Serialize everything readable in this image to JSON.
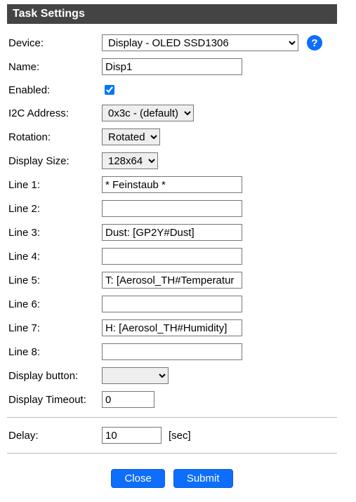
{
  "header": {
    "title": "Task Settings"
  },
  "labels": {
    "device": "Device:",
    "name": "Name:",
    "enabled": "Enabled:",
    "i2c": "I2C Address:",
    "rotation": "Rotation:",
    "displaySize": "Display Size:",
    "line1": "Line 1:",
    "line2": "Line 2:",
    "line3": "Line 3:",
    "line4": "Line 4:",
    "line5": "Line 5:",
    "line6": "Line 6:",
    "line7": "Line 7:",
    "line8": "Line 8:",
    "displayButton": "Display button:",
    "displayTimeout": "Display Timeout:",
    "delay": "Delay:"
  },
  "values": {
    "device": "Display - OLED SSD1306",
    "name": "Disp1",
    "enabled": true,
    "i2c": "0x3c - (default)",
    "rotation": "Rotated",
    "displaySize": "128x64",
    "line1": "* Feinstaub *",
    "line2": "",
    "line3": "Dust: [GP2Y#Dust]",
    "line4": "",
    "line5": "T: [Aerosol_TH#Temperatur",
    "line6": "",
    "line7": "H: [Aerosol_TH#Humidity]",
    "line8": "",
    "displayButton": "",
    "displayTimeout": "0",
    "delay": "10"
  },
  "units": {
    "delay": "[sec]"
  },
  "buttons": {
    "close": "Close",
    "submit": "Submit"
  },
  "helpGlyph": "?"
}
